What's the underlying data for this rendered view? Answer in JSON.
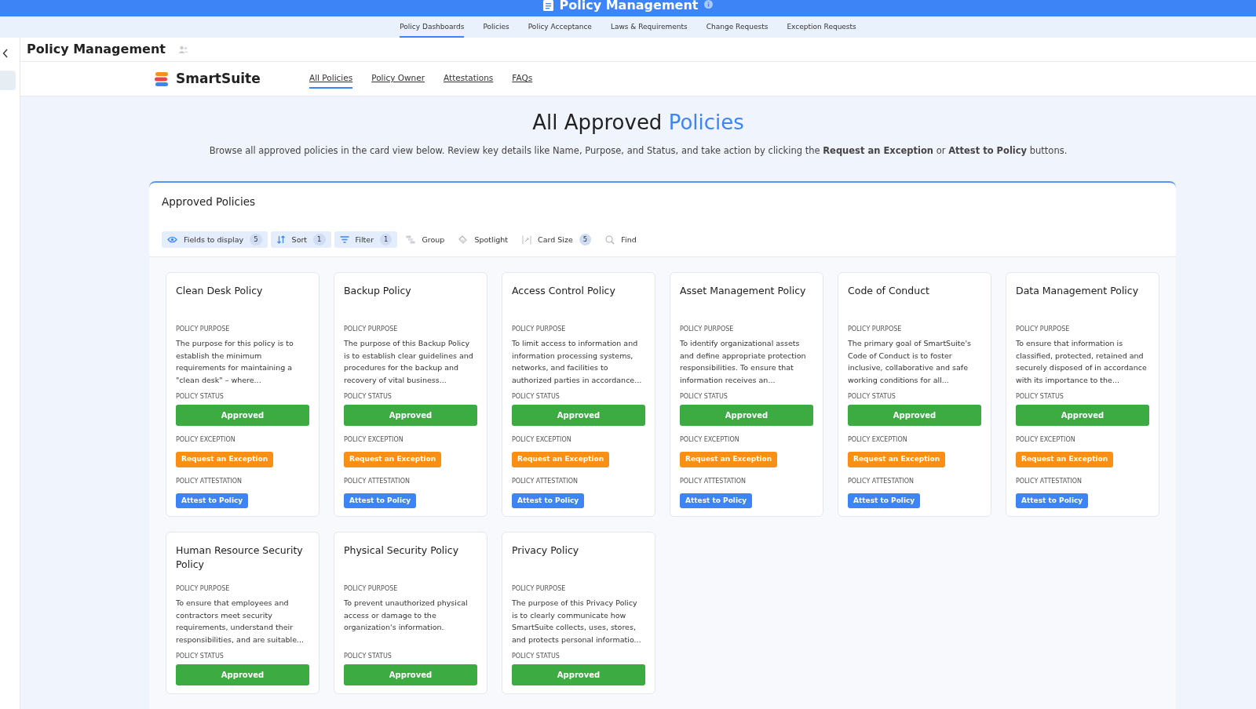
{
  "app_bar": {
    "title": "Policy Management"
  },
  "tabs": [
    {
      "label": "Policy Dashboards",
      "selected": true
    },
    {
      "label": "Policies",
      "selected": false
    },
    {
      "label": "Policy Acceptance",
      "selected": false
    },
    {
      "label": "Laws & Requirements",
      "selected": false
    },
    {
      "label": "Change Requests",
      "selected": false
    },
    {
      "label": "Exception Requests",
      "selected": false
    }
  ],
  "page_header": {
    "title": "Policy Management"
  },
  "portal_nav": {
    "brand": "SmartSuite",
    "links": [
      {
        "label": "All Policies",
        "selected": true
      },
      {
        "label": "Policy Owner",
        "selected": false
      },
      {
        "label": "Attestations",
        "selected": false
      },
      {
        "label": "FAQs",
        "selected": false
      }
    ]
  },
  "hero": {
    "title": "All Approved",
    "title_highlight": "Policies",
    "description": "Browse all approved policies in the card view below. Review key details like Name, Purpose, and Status, and take action by clicking the **Request an Exception** or **Attest to Policy** buttons."
  },
  "panel": {
    "title": "Approved Policies",
    "toolbar": [
      {
        "kind": "fields",
        "label": "Fields to display",
        "count": "5",
        "on": true
      },
      {
        "kind": "sort",
        "label": "Sort",
        "count": "1",
        "on": true
      },
      {
        "kind": "filter",
        "label": "Filter",
        "count": "1",
        "on": true
      },
      {
        "kind": "group",
        "label": "Group",
        "on": false
      },
      {
        "kind": "spotlight",
        "label": "Spotlight",
        "on": false
      },
      {
        "kind": "cardsize",
        "label": "Card Size",
        "count": "5",
        "on": false
      },
      {
        "kind": "find",
        "label": "Find",
        "on": false
      }
    ],
    "cards": [
      {
        "title": "Clean Desk Policy",
        "purpose_label": "POLICY PURPOSE",
        "purpose": "The purpose for this policy is to establish the minimum requirements for maintaining a \"clean desk\" – where...",
        "status_label": "POLICY STATUS",
        "status": "Approved",
        "exception_label": "POLICY EXCEPTION",
        "exception_button": "Request an Exception",
        "attestation_label": "POLICY ATTESTATION",
        "attestation_button": "Attest to Policy"
      },
      {
        "title": "Backup Policy",
        "purpose_label": "POLICY PURPOSE",
        "purpose": "The purpose of this Backup Policy is to establish clear guidelines and procedures for the backup and recovery of vital business...",
        "status_label": "POLICY STATUS",
        "status": "Approved",
        "exception_label": "POLICY EXCEPTION",
        "exception_button": "Request an Exception",
        "attestation_label": "POLICY ATTESTATION",
        "attestation_button": "Attest to Policy"
      },
      {
        "title": "Access Control Policy",
        "purpose_label": "POLICY PURPOSE",
        "purpose": "To limit access to information and information processing systems, networks, and facilities to authorized parties in accordance...",
        "status_label": "POLICY STATUS",
        "status": "Approved",
        "exception_label": "POLICY EXCEPTION",
        "exception_button": "Request an Exception",
        "attestation_label": "POLICY ATTESTATION",
        "attestation_button": "Attest to Policy"
      },
      {
        "title": "Asset Management Policy",
        "purpose_label": "POLICY PURPOSE",
        "purpose": "To identify organizational assets and define appropriate protection responsibilities. To ensure that information receives an...",
        "status_label": "POLICY STATUS",
        "status": "Approved",
        "exception_label": "POLICY EXCEPTION",
        "exception_button": "Request an Exception",
        "attestation_label": "POLICY ATTESTATION",
        "attestation_button": "Attest to Policy"
      },
      {
        "title": "Code of Conduct",
        "purpose_label": "POLICY PURPOSE",
        "purpose": "The primary goal of SmartSuite's Code of Conduct is to foster inclusive, collaborative and safe working conditions for all...",
        "status_label": "POLICY STATUS",
        "status": "Approved",
        "exception_label": "POLICY EXCEPTION",
        "exception_button": "Request an Exception",
        "attestation_label": "POLICY ATTESTATION",
        "attestation_button": "Attest to Policy"
      },
      {
        "title": "Data Management Policy",
        "purpose_label": "POLICY PURPOSE",
        "purpose": "To ensure that information is classified, protected, retained and securely disposed of in accordance with its importance to the...",
        "status_label": "POLICY STATUS",
        "status": "Approved",
        "exception_label": "POLICY EXCEPTION",
        "exception_button": "Request an Exception",
        "attestation_label": "POLICY ATTESTATION",
        "attestation_button": "Attest to Policy"
      },
      {
        "title": "Human Resource Security Policy",
        "purpose_label": "POLICY PURPOSE",
        "purpose": "To ensure that employees and contractors meet security requirements, understand their responsibilities, and are suitable...",
        "status_label": "POLICY STATUS",
        "status": "Approved"
      },
      {
        "title": "Physical Security Policy",
        "purpose_label": "POLICY PURPOSE",
        "purpose": "To prevent unauthorized physical access or damage to the organization's information.",
        "status_label": "POLICY STATUS",
        "status": "Approved"
      },
      {
        "title": "Privacy Policy",
        "purpose_label": "POLICY PURPOSE",
        "purpose": "The purpose of this Privacy Policy is to clearly communicate how SmartSuite collects, uses, stores, and protects personal informatio...",
        "status_label": "POLICY STATUS",
        "status": "Approved"
      }
    ]
  }
}
